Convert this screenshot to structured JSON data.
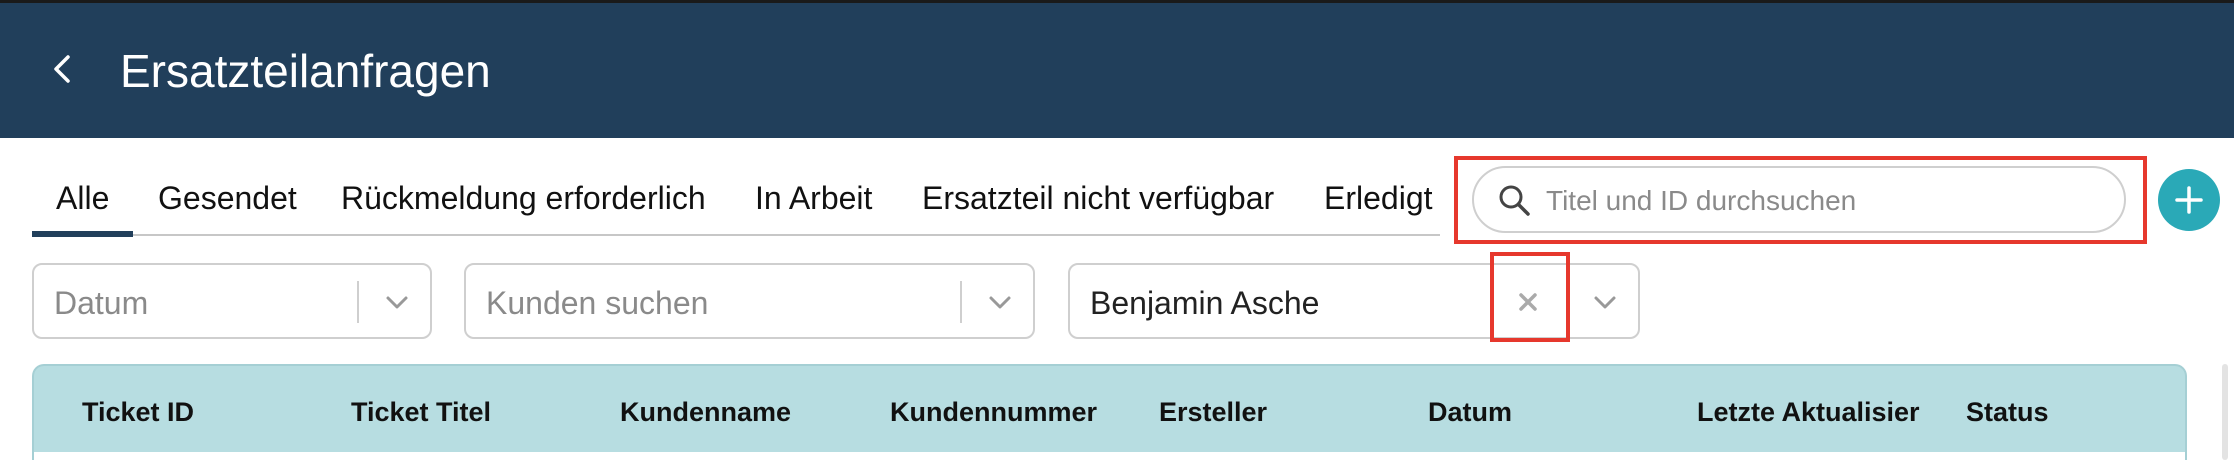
{
  "header": {
    "title": "Ersatzteilanfragen",
    "background": "#213f5b"
  },
  "tabs": [
    {
      "label": "Alle",
      "active": true
    },
    {
      "label": "Gesendet"
    },
    {
      "label": "Rückmeldung erforderlich"
    },
    {
      "label": "In Arbeit"
    },
    {
      "label": "Ersatzteil nicht verfügbar"
    },
    {
      "label": "Erledigt"
    }
  ],
  "search": {
    "placeholder": "Titel und ID durchsuchen",
    "value": ""
  },
  "filters": {
    "date": {
      "placeholder": "Datum"
    },
    "customer": {
      "placeholder": "Kunden suchen"
    },
    "creator": {
      "value": "Benjamin Asche"
    }
  },
  "table": {
    "columns": [
      "Ticket ID",
      "Ticket Titel",
      "Kundenname",
      "Kundennummer",
      "Ersteller",
      "Datum",
      "Letzte Aktualisier",
      "Status"
    ]
  },
  "colors": {
    "accent": "#2aa9b7",
    "highlight": "#e6382d",
    "table_header": "#b7dde1"
  },
  "icons": {
    "back": "chevron-left-icon",
    "search": "search-icon",
    "add": "plus-icon",
    "clear": "close-icon",
    "dropdown": "chevron-down-icon"
  }
}
